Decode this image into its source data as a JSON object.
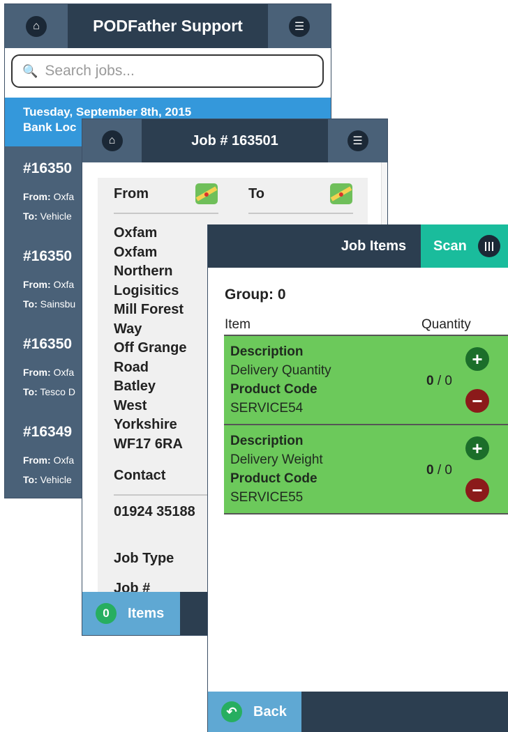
{
  "support_screen": {
    "title": "PODFather Support",
    "search_placeholder": "Search jobs...",
    "date_header": {
      "line1": "Tuesday, September 8th, 2015",
      "line2": "Bank Loc"
    },
    "jobs": [
      {
        "number": "#16350",
        "from_label": "From:",
        "from_value": "Oxfa",
        "to_label": "To:",
        "to_value": "Vehicle"
      },
      {
        "number": "#16350",
        "from_label": "From:",
        "from_value": "Oxfa",
        "to_label": "To:",
        "to_value": "Sainsbu"
      },
      {
        "number": "#16350",
        "from_label": "From:",
        "from_value": "Oxfa",
        "to_label": "To:",
        "to_value": "Tesco D"
      },
      {
        "number": "#16349",
        "from_label": "From:",
        "from_value": "Oxfa",
        "to_label": "To:",
        "to_value": "Vehicle"
      }
    ]
  },
  "job_screen": {
    "title": "Job # 163501",
    "from_label": "From",
    "to_label": "To",
    "address_lines": [
      "Oxfam",
      "Oxfam",
      "Northern",
      "Logisitics",
      "Mill Forest",
      "Way",
      "Off Grange",
      "Road",
      "Batley",
      "West",
      "Yorkshire",
      "WF17 6RA"
    ],
    "contact_label": "Contact",
    "contact_value": "01924 35188",
    "job_type_label": "Job Type",
    "job_num_label": "Job #",
    "items_count": "0",
    "items_label": "Items"
  },
  "items_screen": {
    "title": "Job Items",
    "scan_label": "Scan",
    "group_label": "Group: 0",
    "col_item": "Item",
    "col_quantity": "Quantity",
    "items": [
      {
        "desc_label": "Description",
        "desc_value": "Delivery Quantity",
        "code_label": "Product Code",
        "code_value": "SERVICE54",
        "qty_done": "0",
        "qty_total": "/ 0"
      },
      {
        "desc_label": "Description",
        "desc_value": "Delivery Weight",
        "code_label": "Product Code",
        "code_value": "SERVICE55",
        "qty_done": "0",
        "qty_total": "/ 0"
      }
    ],
    "back_label": "Back"
  },
  "colors": {
    "navy": "#2c3e50",
    "slate": "#4a6178",
    "blue": "#3498db",
    "teal": "#1abc9c",
    "green_row": "#6cc95b",
    "light_blue_btn": "#5fa8d3"
  },
  "icons": [
    "home-icon",
    "menu-icon",
    "search-icon",
    "map-icon",
    "barcode-icon",
    "plus-icon",
    "minus-icon",
    "back-icon"
  ]
}
